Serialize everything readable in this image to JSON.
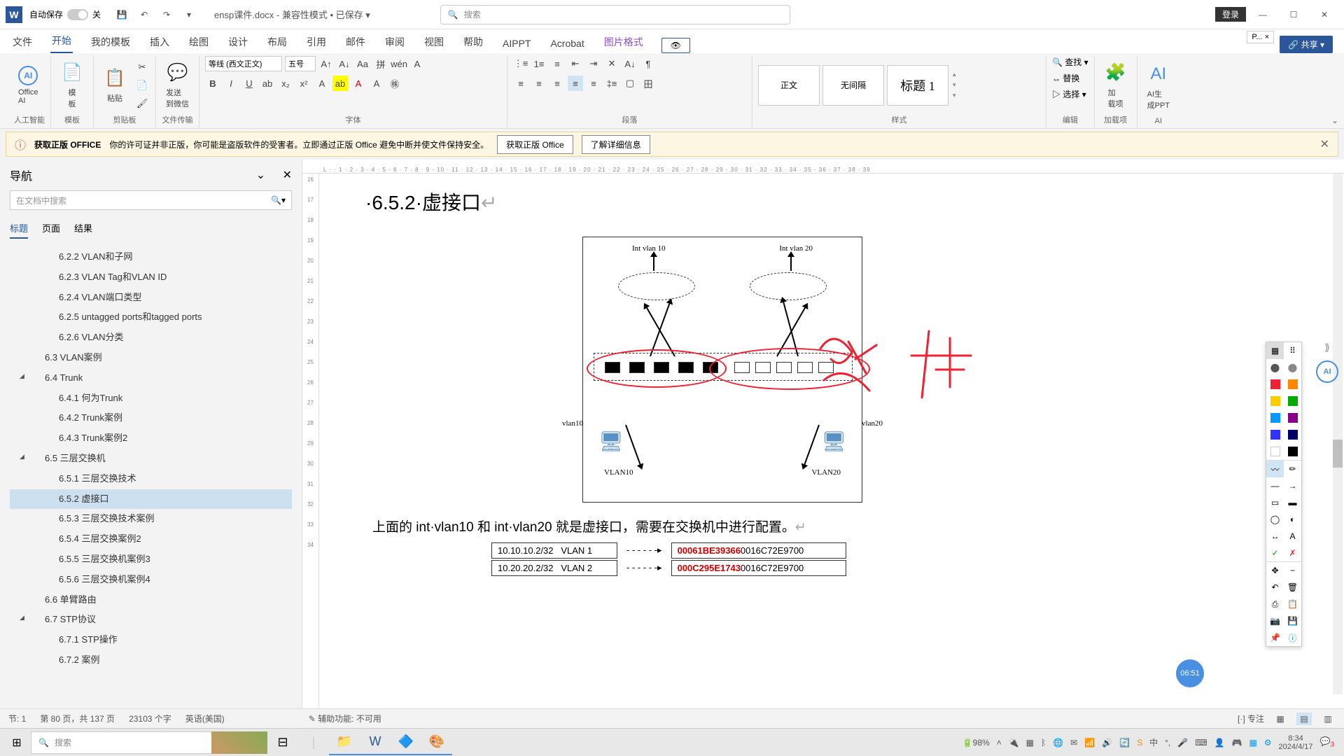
{
  "titlebar": {
    "autosave": "自动保存",
    "autosave_state": "关",
    "doc_name": "ensp课件.docx",
    "compat": "兼容性模式",
    "saved": "已保存",
    "search_placeholder": "搜索",
    "login": "登录"
  },
  "tabs": {
    "file": "文件",
    "home": "开始",
    "templates": "我的模板",
    "insert": "插入",
    "draw": "绘图",
    "design": "设计",
    "layout": "布局",
    "references": "引用",
    "mailings": "邮件",
    "review": "审阅",
    "view": "视图",
    "help": "帮助",
    "aippt": "AIPPT",
    "acrobat": "Acrobat",
    "picture_format": "图片格式",
    "share": "共享"
  },
  "ribbon": {
    "ai": "人工智能",
    "office_ai": "Office\nAI",
    "template_group": "模板",
    "template": "模\n板",
    "clipboard_group": "剪贴板",
    "paste": "粘贴",
    "file_transfer_group": "文件传输",
    "send_wechat": "发送\n到微信",
    "font_group": "字体",
    "font_name": "等线 (西文正文)",
    "font_size": "五号",
    "para_group": "段落",
    "styles_group": "样式",
    "style_normal": "正文",
    "style_nospacing": "无间隔",
    "style_heading1": "标题 1",
    "edit_group": "编辑",
    "find": "查找",
    "replace": "替换",
    "select": "选择",
    "addins_group": "加载项",
    "addins": "加\n载项",
    "ai_gen": "AI生\n成PPT"
  },
  "warning": {
    "title": "获取正版 OFFICE",
    "body": "你的许可证并非正版，你可能是盗版软件的受害者。立即通过正版 Office 避免中断并使文件保持安全。",
    "btn1": "获取正版 Office",
    "btn2": "了解详细信息"
  },
  "nav": {
    "title": "导航",
    "search_placeholder": "在文档中搜索",
    "tab_headings": "标题",
    "tab_pages": "页面",
    "tab_results": "结果",
    "items": [
      {
        "l": 3,
        "t": "6.2.2 VLAN和子网"
      },
      {
        "l": 3,
        "t": "6.2.3 VLAN Tag和VLAN ID"
      },
      {
        "l": 3,
        "t": "6.2.4 VLAN端口类型"
      },
      {
        "l": 3,
        "t": "6.2.5 untagged ports和tagged ports"
      },
      {
        "l": 3,
        "t": "6.2.6 VLAN分类"
      },
      {
        "l": 2,
        "t": "6.3 VLAN案例"
      },
      {
        "l": 2,
        "t": "6.4 Trunk",
        "caret": true
      },
      {
        "l": 3,
        "t": "6.4.1 何为Trunk"
      },
      {
        "l": 3,
        "t": "6.4.2 Trunk案例"
      },
      {
        "l": 3,
        "t": "6.4.3 Trunk案例2"
      },
      {
        "l": 2,
        "t": "6.5 三层交换机",
        "caret": true
      },
      {
        "l": 3,
        "t": "6.5.1 三层交换技术"
      },
      {
        "l": 3,
        "t": "6.5.2 虚接口",
        "sel": true
      },
      {
        "l": 3,
        "t": "6.5.3 三层交换技术案例"
      },
      {
        "l": 3,
        "t": "6.5.4 三层交换案例2"
      },
      {
        "l": 3,
        "t": "6.5.5 三层交换机案例3"
      },
      {
        "l": 3,
        "t": "6.5.6 三层交换机案例4"
      },
      {
        "l": 2,
        "t": "6.6 单臂路由"
      },
      {
        "l": 2,
        "t": "6.7 STP协议",
        "caret": true
      },
      {
        "l": 3,
        "t": "6.7.1 STP操作"
      },
      {
        "l": 3,
        "t": "6.7.2 案例"
      }
    ]
  },
  "doc": {
    "heading_prefix": "·6.5.2·",
    "heading_text": "虚接口",
    "diagram": {
      "int_vlan10": "Int vlan 10",
      "int_vlan20": "Int vlan 20",
      "vlan10": "vlan10",
      "vlan20": "vlan20",
      "VLAN10": "VLAN10",
      "VLAN20": "VLAN20"
    },
    "body": "上面的 int·vlan10 和 int·vlan20 就是虚接口，需要在交换机中进行配置。",
    "table": [
      {
        "ip": "10.10.10.2/32",
        "vlan": "VLAN 1",
        "mac_red": "00061BE39366",
        "mac_rest": "0016C72E9700"
      },
      {
        "ip": "10.20.20.2/32",
        "vlan": "VLAN 2",
        "mac_red": "000C295E1743",
        "mac_rest": "0016C72E9700"
      }
    ]
  },
  "status": {
    "section": "节: 1",
    "page": "第 80 页，共 137 页",
    "words": "23103 个字",
    "lang": "英语(美国)",
    "accessibility": "辅助功能: 不可用",
    "focus": "专注"
  },
  "taskbar": {
    "search": "搜索",
    "battery": "98%",
    "time": "8:34",
    "date": "2024/4/17"
  },
  "float_time": "06:51",
  "ruler_h": "L · · 1 · 2 · 3 · 4 · 5 · 6 · 7 · 8 · 9 · 10 · 11 · 12 · 13 · 14 · 15 · 16 · 17 · 18 · 19 · 20 · 21 · 22 · 23 · 24 · 25 · 26 · 27 · 28 · 29 · 30 · 31 · 32 · 33 · 34 · 35 · 36 · 37 · 38 · 39"
}
